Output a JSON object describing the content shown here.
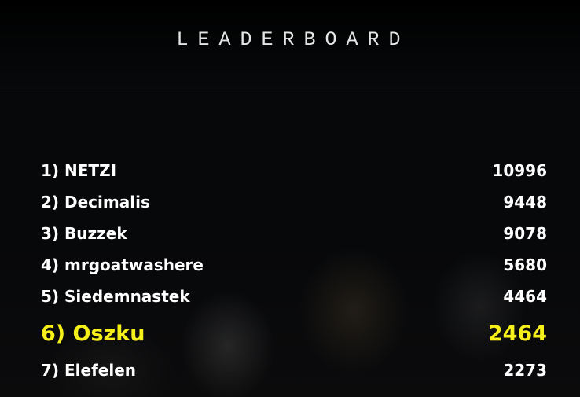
{
  "title": "LEADERBOARD",
  "highlight_color": "#f6f01a",
  "entries": [
    {
      "label": "1) NETZI",
      "score": "10996"
    },
    {
      "label": "2) Decimalis",
      "score": "9448"
    },
    {
      "label": "3) Buzzek",
      "score": "9078"
    },
    {
      "label": "4) mrgoatwashere",
      "score": "5680"
    },
    {
      "label": "5) Siedemnastek",
      "score": "4464"
    },
    {
      "label": "6) Oszku",
      "score": "2464"
    },
    {
      "label": "7) Elefelen",
      "score": "2273"
    }
  ]
}
